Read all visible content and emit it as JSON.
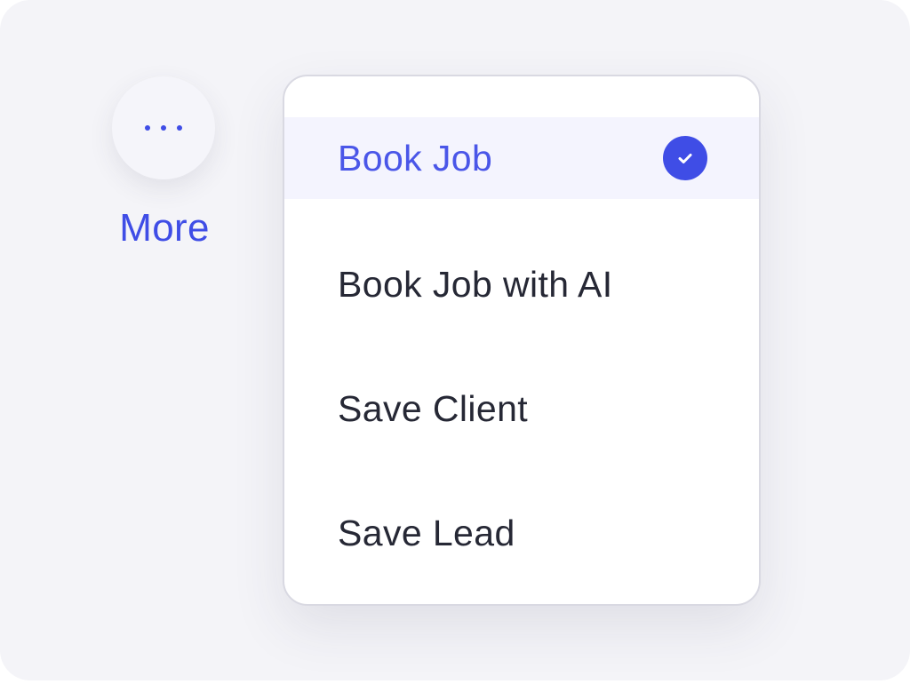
{
  "colors": {
    "accent": "#3f4de6",
    "background": "#f4f4f8",
    "selected_row": "#f4f4fe",
    "text": "#262835"
  },
  "more": {
    "icon": "ellipsis-icon",
    "label": "More"
  },
  "menu": {
    "items": [
      {
        "label": "Book Job",
        "selected": true,
        "icon": "check-circle-icon"
      },
      {
        "label": "Book Job with AI",
        "selected": false
      },
      {
        "label": "Save Client",
        "selected": false
      },
      {
        "label": "Save Lead",
        "selected": false
      }
    ]
  }
}
